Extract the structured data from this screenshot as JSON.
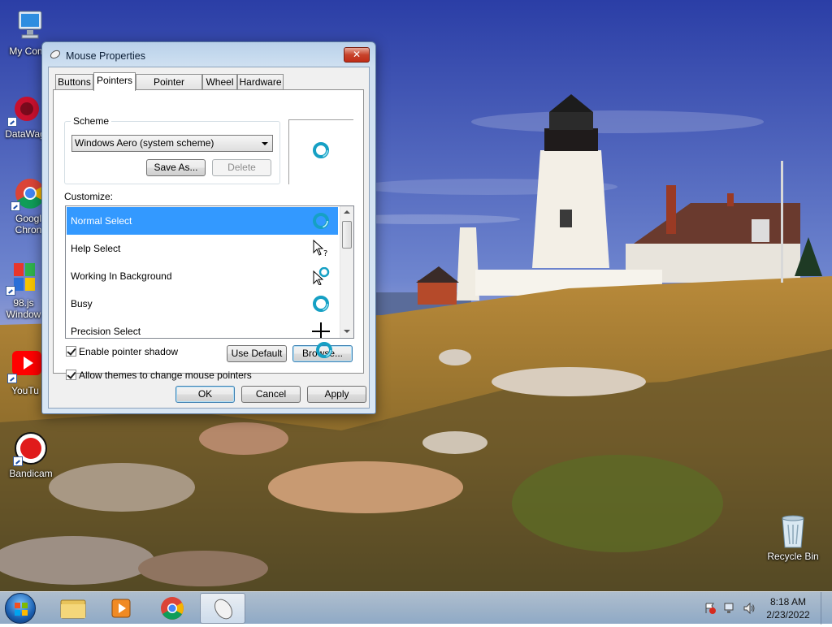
{
  "desktop": {
    "icons": [
      {
        "label": "My Comp",
        "icon": "computer-icon"
      },
      {
        "label": "DataWag",
        "icon": "datawagon-icon"
      },
      {
        "label": "Googl",
        "label2": "Chron",
        "icon": "chrome-icon"
      },
      {
        "label": "98.js",
        "label2": "Window",
        "icon": "windows98-icon"
      },
      {
        "label": "YouTu",
        "icon": "youtube-icon"
      },
      {
        "label": "Bandicam",
        "icon": "bandicam-icon"
      },
      {
        "label": "Recycle Bin",
        "icon": "recycle-bin-icon"
      }
    ]
  },
  "window": {
    "title": "Mouse Properties",
    "close_label": "✕",
    "tabs": [
      {
        "label": "Buttons",
        "active": false
      },
      {
        "label": "Pointers",
        "active": true
      },
      {
        "label": "Pointer Options",
        "active": false
      },
      {
        "label": "Wheel",
        "active": false
      },
      {
        "label": "Hardware",
        "active": false
      }
    ],
    "scheme": {
      "legend": "Scheme",
      "selected": "Windows Aero (system scheme)",
      "save_as": "Save As...",
      "delete": "Delete"
    },
    "customize": {
      "label": "Customize:",
      "items": [
        {
          "label": "Normal Select",
          "icon": "busy-ring-icon",
          "selected": true
        },
        {
          "label": "Help Select",
          "icon": "help-select-cursor-icon",
          "selected": false
        },
        {
          "label": "Working In Background",
          "icon": "working-cursor-icon",
          "selected": false
        },
        {
          "label": "Busy",
          "icon": "busy-ring-icon",
          "selected": false
        },
        {
          "label": "Precision Select",
          "icon": "crosshair-cursor-icon",
          "selected": false
        }
      ]
    },
    "enable_shadow": {
      "label": "Enable pointer shadow",
      "checked": true
    },
    "allow_themes": {
      "label": "Allow themes to change mouse pointers",
      "checked": true
    },
    "use_default": "Use Default",
    "browse": "Browse...",
    "ok": "OK",
    "cancel": "Cancel",
    "apply": "Apply"
  },
  "taskbar": {
    "pinned": [
      "start-orb",
      "file-explorer-icon",
      "media-player-icon",
      "chrome-icon",
      "mouse-properties-icon"
    ],
    "tray_icons": [
      "action-center-icon",
      "network-icon",
      "volume-icon"
    ],
    "time": "8:18 AM",
    "date": "2/23/2022"
  },
  "colors": {
    "selection": "#3399ff",
    "sky_top": "#2a3fa8",
    "close_button": "#c7432b"
  }
}
